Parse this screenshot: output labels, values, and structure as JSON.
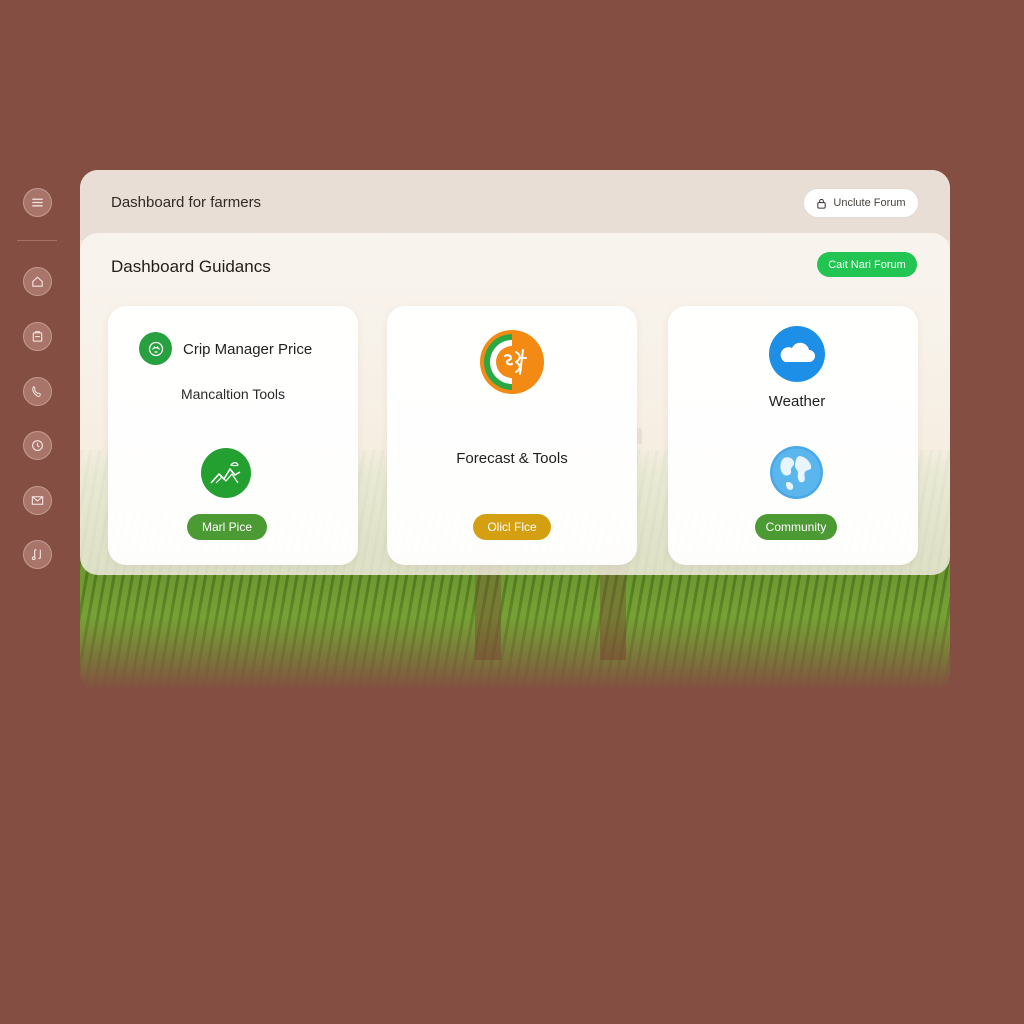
{
  "colors": {
    "background": "#844e42",
    "accent_green": "#23c552",
    "pill_green": "#4c9a33",
    "pill_gold": "#d4a012",
    "forecast_orange": "#f28a14",
    "weather_blue": "#1d8fe6"
  },
  "sidebar": {
    "items": [
      {
        "icon": "menu-icon"
      },
      {
        "icon": "home-icon"
      },
      {
        "icon": "clipboard-icon"
      },
      {
        "icon": "phone-icon"
      },
      {
        "icon": "clock-icon"
      },
      {
        "icon": "mail-icon"
      },
      {
        "icon": "music-icon"
      }
    ]
  },
  "header": {
    "title": "Dashboard for farmers",
    "forum_button": "Unclute Forum",
    "forum_icon": "lock-icon"
  },
  "panel": {
    "title": "Dashboard Guidancs",
    "action_button": "Cait Nari Forum"
  },
  "cards": [
    {
      "heading": "Crip Manager Price",
      "subheading": "Mancaltion Tools",
      "badge_icon": "crop-badge-icon",
      "icon": "market-chart-icon",
      "button": "Marl Pice"
    },
    {
      "heading": "Forecast & Tools",
      "icon": "forecast-icon",
      "button": "Olicl Flce"
    },
    {
      "heading": "Weather",
      "icon": "cloud-icon",
      "secondary_icon": "globe-icon",
      "button": "Community"
    }
  ]
}
